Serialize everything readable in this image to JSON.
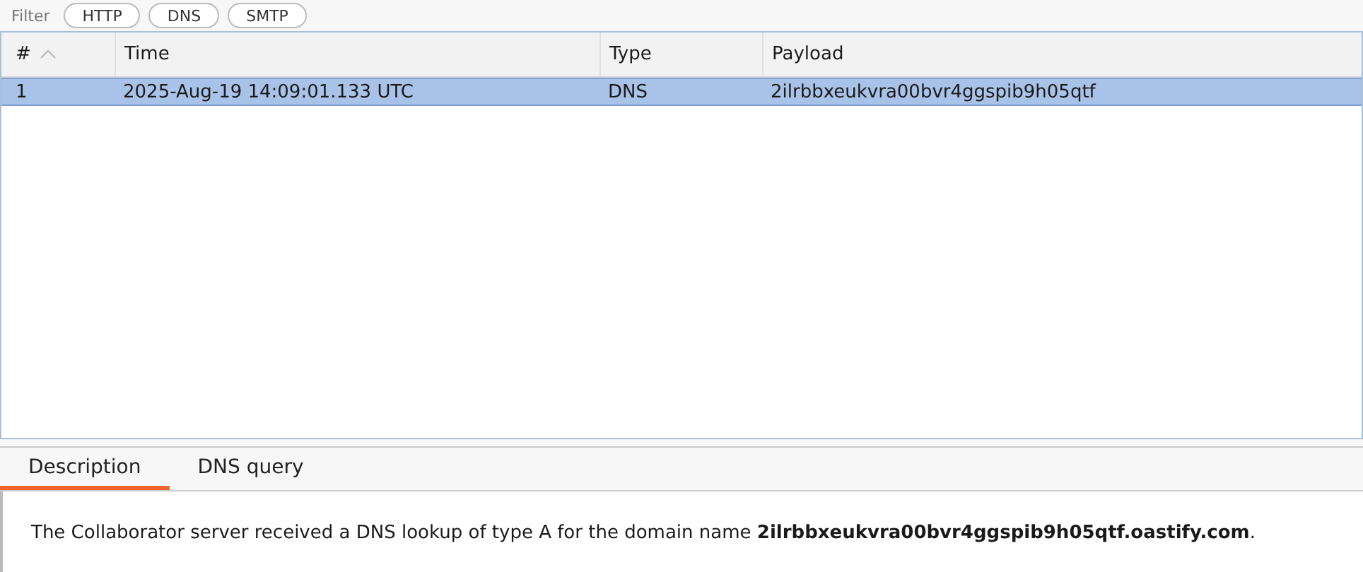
{
  "filter": {
    "label": "Filter",
    "chips": [
      {
        "label": "HTTP",
        "selected": false
      },
      {
        "label": "DNS",
        "selected": false
      },
      {
        "label": "SMTP",
        "selected": false
      }
    ]
  },
  "table": {
    "columns": [
      {
        "label": "#",
        "sorted": true
      },
      {
        "label": "Time",
        "sorted": false
      },
      {
        "label": "Type",
        "sorted": false
      },
      {
        "label": "Payload",
        "sorted": false
      }
    ],
    "rows": [
      {
        "cells": [
          "1",
          "2025-Aug-19 14:09:01.133 UTC",
          "DNS",
          "2ilrbbxeukvra00bvr4ggspib9h05qtf"
        ],
        "selected": true
      }
    ]
  },
  "tabs": [
    {
      "label": "Description",
      "selected": true
    },
    {
      "label": "DNS query",
      "selected": false
    }
  ],
  "description": "The Collaborator server received a DNS lookup of type A for the domain name **2ilrbbxeukvra00bvr4ggspib9h05qtf.oastify.com**."
}
